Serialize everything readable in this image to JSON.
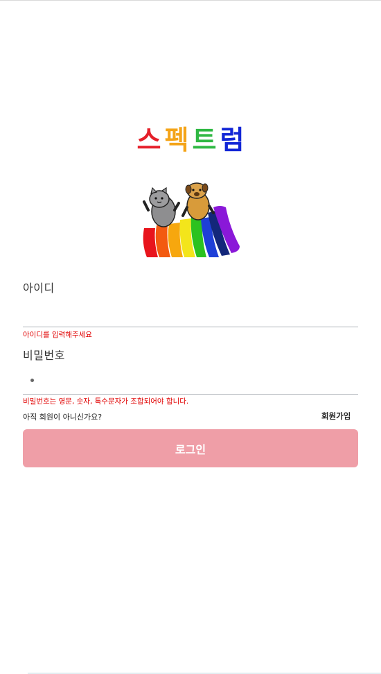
{
  "brand": {
    "title": "스펙트럼",
    "letters": [
      {
        "char": "스",
        "color": "#e5202a"
      },
      {
        "char": "펙",
        "color": "#f4a419"
      },
      {
        "char": "트",
        "color": "#2fb843"
      },
      {
        "char": "럼",
        "color": "#1226d6"
      }
    ],
    "mascot_icon": "two-dogs-on-rainbow-slide"
  },
  "form": {
    "id_label": "아이디",
    "id_value": "",
    "id_error": "아이디를 입력해주세요",
    "password_label": "비밀번호",
    "password_error": "비밀번호는 영문, 숫자, 특수문자가 조합되어야 합니다.",
    "signup_prompt": "아직 회원이 아니신가요?",
    "signup_link": "회원가입",
    "login_button": "로그인"
  },
  "colors": {
    "error": "#e10000",
    "button": "#ef9ea7"
  }
}
